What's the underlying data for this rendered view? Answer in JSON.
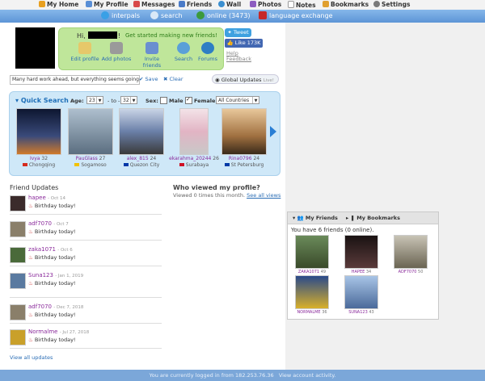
{
  "nav": {
    "items": [
      {
        "label": "My Home",
        "color": "#e8a020"
      },
      {
        "label": "My Profile",
        "color": "#5a8fd6"
      },
      {
        "label": "Messages",
        "color": "#d84a4a"
      },
      {
        "label": "Friends",
        "color": "#4a7bc8"
      },
      {
        "label": "Wall",
        "color": "#3b8fd0"
      },
      {
        "label": "Photos",
        "color": "#8c5cc0"
      },
      {
        "label": "Notes",
        "color": "#c9c9c9"
      },
      {
        "label": "Bookmarks",
        "color": "#e0a030"
      },
      {
        "label": "Settings",
        "color": "#7a7a7a"
      }
    ]
  },
  "band": {
    "interpals": "interpals",
    "search": "search",
    "online": "online (3473)",
    "language_exchange": "language exchange"
  },
  "profile": {
    "hi": "Hi,",
    "exclam": "!",
    "get_started": "Get started making new friends!",
    "actions": [
      {
        "label": "Edit profile",
        "color": "#e6c86a"
      },
      {
        "label": "Add photos",
        "color": "#9a9a9a"
      },
      {
        "label": "Invite friends",
        "color": "#6a8fd0"
      },
      {
        "label": "Search",
        "color": "#5aa0d8"
      },
      {
        "label": "Forums",
        "color": "#2e7fc4"
      }
    ],
    "tweet": "Tweet",
    "like": "Like 173K",
    "help": "Help",
    "feedback": "Feedback"
  },
  "status": {
    "value": "Many hard work ahead, but everything seems going to be",
    "save": "Save",
    "clear": "Clear",
    "global_updates": "Global Updates",
    "live": "Live!"
  },
  "quick_search": {
    "title": "Quick Search",
    "age_label": "Age:",
    "age_from": "23",
    "to_label": "- to -",
    "age_to": "32",
    "sex_label": "Sex:",
    "male": "Male",
    "male_checked": false,
    "female": "Female",
    "female_checked": true,
    "country": "All Countries",
    "results": [
      {
        "user": "Ivya",
        "age": "32",
        "loc": "Chongqing",
        "photo": "#1a2a5a",
        "flag": "#d52b1e"
      },
      {
        "user": "PauGlass",
        "age": "27",
        "loc": "Sogamoso",
        "photo": "#6c8aa0",
        "flag": "#f2c200"
      },
      {
        "user": "alex_815",
        "age": "24",
        "loc": "Quezon City",
        "photo": "#7a8fb5",
        "flag": "#0038a8"
      },
      {
        "user": "ekarahma_20244",
        "age": "26",
        "loc": "Surabaya",
        "photo": "#e9c4cf",
        "flag": "#ce1126"
      },
      {
        "user": "Rina0796",
        "age": "24",
        "loc": "St Petersburg",
        "photo": "#b88a5a",
        "flag": "#0039a6"
      }
    ]
  },
  "friend_updates": {
    "title": "Friend Updates",
    "items": [
      {
        "user": "hapee",
        "date": "- Oct 14",
        "msg": "Birthday today!",
        "thumb": "#3b2b2b"
      },
      {
        "user": "adf7070",
        "date": "- Oct 7",
        "msg": "Birthday today!",
        "thumb": "#8a7f6a"
      },
      {
        "user": "zaka1071",
        "date": "- Oct 6",
        "msg": "Birthday today!",
        "thumb": "#4a6a3a"
      },
      {
        "user": "Suna123",
        "date": "- Jan 1, 2019",
        "msg": "Birthday today!",
        "thumb": "#5a7aa0"
      },
      {
        "user": "adf7070",
        "date": "- Dec 7, 2018",
        "msg": "Birthday today!",
        "thumb": "#8a7f6a"
      },
      {
        "user": "Normalme",
        "date": "- Jul 27, 2018",
        "msg": "Birthday today!",
        "thumb": "#c9a02a"
      }
    ],
    "view_all": "View all updates"
  },
  "who_viewed": {
    "title": "Who viewed my profile?",
    "text": "Viewed 0 times this month.",
    "see_all": "See all views"
  },
  "my_friends": {
    "tab_friends": "My Friends",
    "tab_bookmarks": "My Bookmarks",
    "count_text": "You have 6 friends (0 online).",
    "friends": [
      {
        "user": "ZAKA1071",
        "age": "49",
        "photo": "#5a6a3a"
      },
      {
        "user": "HAPEE",
        "age": "34",
        "photo": "#2b1f1f"
      },
      {
        "user": "ADF7070",
        "age": "50",
        "photo": "#9a9070"
      },
      {
        "user": "NORMALME",
        "age": "36",
        "photo": "#c9a02a"
      },
      {
        "user": "SUNA123",
        "age": "43",
        "photo": "#6a8ab5"
      }
    ]
  },
  "footer": {
    "text": "You are currently logged in from 182.253.76.36",
    "link": "View account activity."
  }
}
